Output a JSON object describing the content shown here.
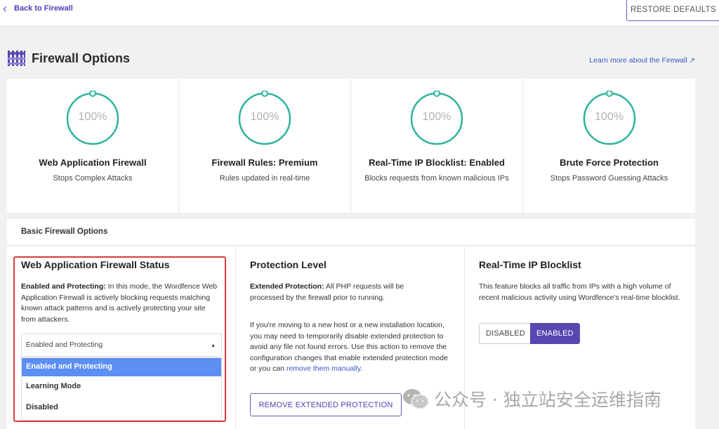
{
  "nav": {
    "back_label": "Back to Firewall",
    "restore_label": "RESTORE DEFAULTS"
  },
  "header": {
    "title": "Firewall Options",
    "learn_more": "Learn more about the Firewall"
  },
  "cards": [
    {
      "percent": "100%",
      "title": "Web Application Firewall",
      "subtitle": "Stops Complex Attacks"
    },
    {
      "percent": "100%",
      "title": "Firewall Rules: Premium",
      "subtitle": "Rules updated in real-time"
    },
    {
      "percent": "100%",
      "title": "Real-Time IP Blocklist: Enabled",
      "subtitle": "Blocks requests from known malicious IPs"
    },
    {
      "percent": "100%",
      "title": "Brute Force Protection",
      "subtitle": "Stops Password Guessing Attacks"
    }
  ],
  "basic": {
    "title": "Basic Firewall Options"
  },
  "waf_status": {
    "title": "Web Application Firewall Status",
    "desc_strong": "Enabled and Protecting:",
    "desc_text": " In this mode, the Wordfence Web Application Firewall is actively blocking requests matching known attack patterns and is actively protecting your site from attackers.",
    "select_value": "Enabled and Protecting",
    "options": [
      "Enabled and Protecting",
      "Learning Mode",
      "Disabled"
    ]
  },
  "protection": {
    "title": "Protection Level",
    "desc_strong": "Extended Protection:",
    "desc_text": " All PHP requests will be processed by the firewall prior to running.",
    "note_text": "If you're moving to a new host or a new installation location, you may need to temporarily disable extended protection to avoid any file not found errors. Use this action to remove the configuration changes that enable extended protection mode or you can ",
    "note_link": "remove them manually",
    "note_end": ".",
    "button_label": "REMOVE EXTENDED PROTECTION"
  },
  "blocklist": {
    "title": "Real-Time IP Blocklist",
    "desc": "This feature blocks all traffic from IPs with a high volume of recent malicious activity using Wordfence's real-time blocklist.",
    "toggle_off": "DISABLED",
    "toggle_on": "ENABLED",
    "state": "enabled"
  },
  "watermark": {
    "text": "公众号 · 独立站安全运维指南"
  },
  "colors": {
    "accent": "#5a46b1",
    "ring": "#2db39e",
    "link": "#3a57c9",
    "highlight_border": "#d93a3a"
  }
}
